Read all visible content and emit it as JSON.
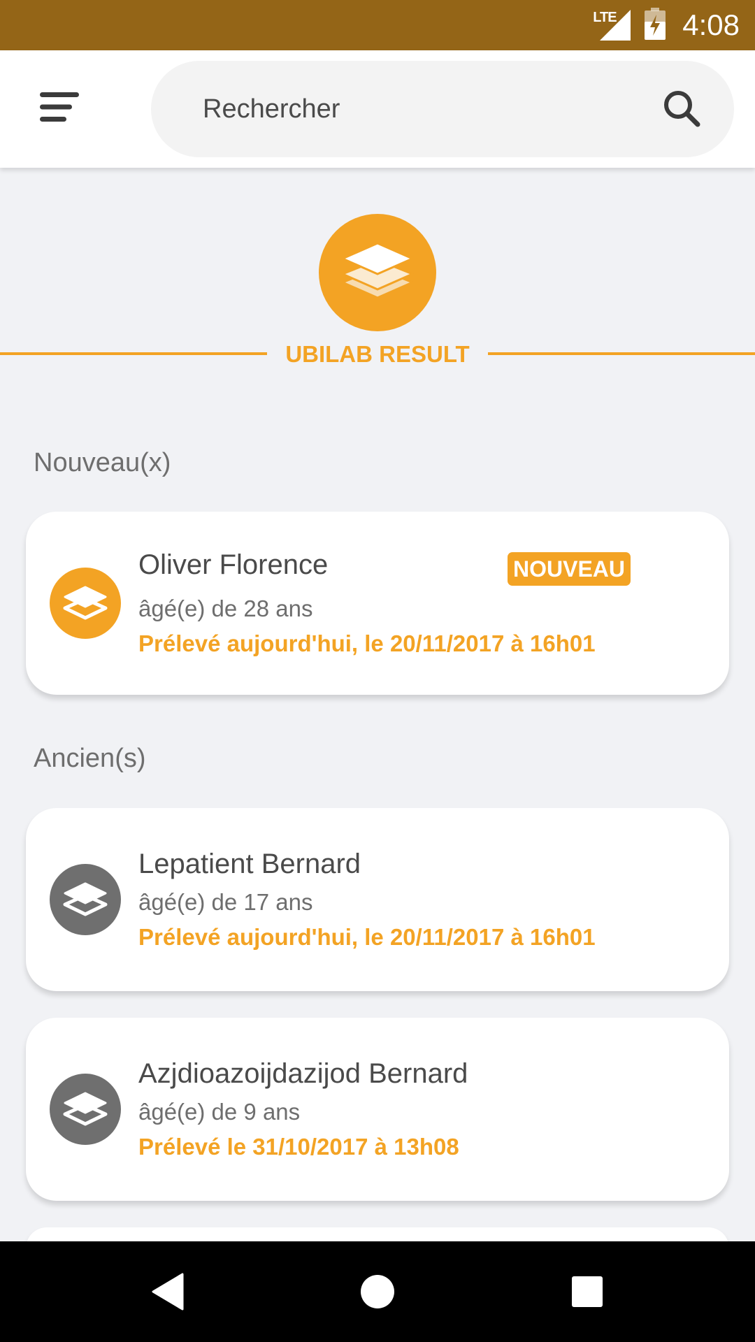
{
  "status_bar": {
    "network": "LTE",
    "time": "4:08"
  },
  "search": {
    "placeholder": "Rechercher"
  },
  "brand": {
    "name": "UBILAB RESULT",
    "accent_color": "#f3a324"
  },
  "sections": {
    "new_label": "Nouveau(x)",
    "old_label": "Ancien(s)"
  },
  "new_results": [
    {
      "name": "Oliver Florence",
      "badge": "NOUVEAU",
      "age": "âgé(e) de 28 ans",
      "date": "Prélevé aujourd'hui, le 20/11/2017 à 16h01",
      "icon": "layers-icon"
    }
  ],
  "old_results": [
    {
      "name": "Lepatient Bernard",
      "age": "âgé(e) de 17 ans",
      "date": "Prélevé aujourd'hui, le 20/11/2017 à 16h01",
      "icon": "layers-icon"
    },
    {
      "name": "Azjdioazoijdazijod Bernard",
      "age": "âgé(e) de 9 ans",
      "date": "Prélevé le 31/10/2017 à 13h08",
      "icon": "layers-icon"
    }
  ],
  "icons": {
    "menu": "menu-icon",
    "search": "search-icon",
    "logo": "layers-icon",
    "nav_back": "back-icon",
    "nav_home": "home-icon",
    "nav_recents": "recents-icon"
  },
  "colors": {
    "status_bar": "#946517",
    "accent": "#f3a324",
    "inactive_avatar": "#6f6f6f",
    "background": "#f1f2f5"
  }
}
